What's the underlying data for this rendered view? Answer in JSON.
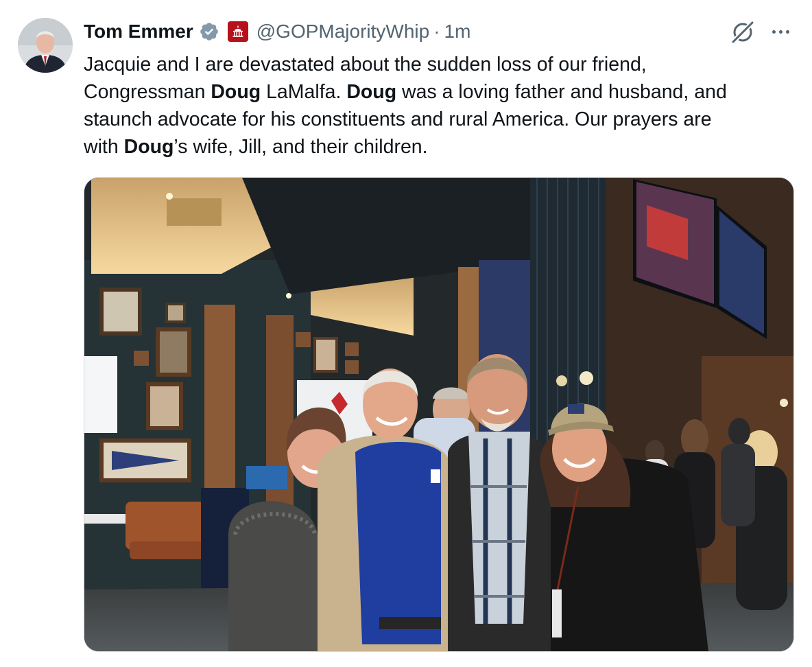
{
  "author": {
    "name": "Tom Emmer",
    "handle": "@GOPMajorityWhip",
    "separator": "·",
    "time": "1m"
  },
  "icons": {
    "avatar": "profile-photo",
    "verified": "verified-badge-icon",
    "affiliation": "capitol-affiliation-icon",
    "grok": "grok-icon",
    "more": "more-options-icon"
  },
  "colors": {
    "text": "#0f1419",
    "secondary": "#536471",
    "verified_badge": "#829aab",
    "affiliation_badge": "#b5121b"
  },
  "tweet": {
    "line1": "Jacquie and I are devastated about the sudden loss of our friend,",
    "line2_pre": "Congressman ",
    "doug_1": "Doug",
    "line2_mid": " LaMalfa. ",
    "doug_2": "Doug",
    "line2_post": " was a loving father and husband, and",
    "line3": "staunch advocate for his constituents and rural America. Our prayers are",
    "line4_pre": "with ",
    "doug_3": "Doug",
    "line4_post": "’s wife, Jill, and their children."
  }
}
